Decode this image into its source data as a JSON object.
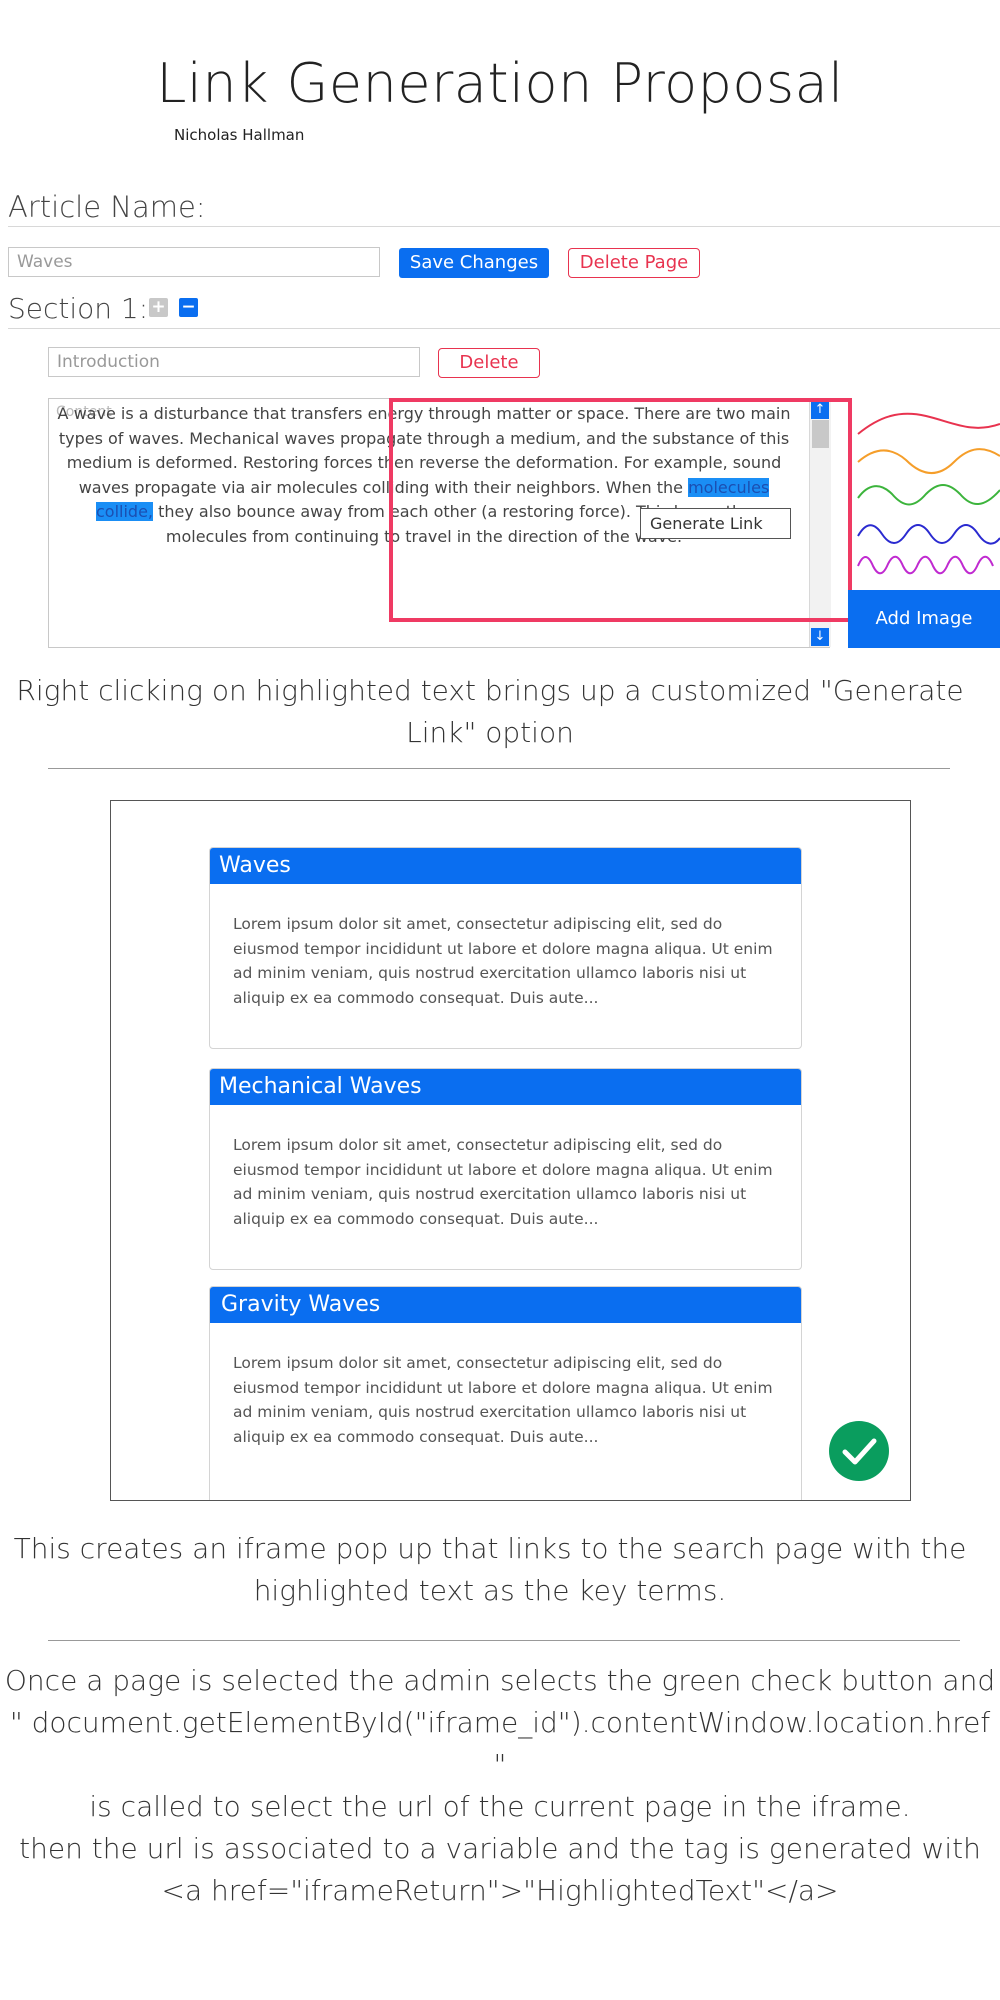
{
  "header": {
    "title": "Link Generation Proposal",
    "author": "Nicholas Hallman"
  },
  "article": {
    "label": "Article Name:",
    "name_value": "Waves",
    "save_label": "Save Changes",
    "delete_page_label": "Delete Page"
  },
  "section": {
    "label": "Section 1:",
    "add_icon": "plus-icon",
    "remove_icon": "minus-icon",
    "title_value": "Introduction",
    "delete_label": "Delete",
    "content_placeholder": "Content",
    "content_before": "A wave is a disturbance that transfers energy through matter or space. There are two main types of waves. Mechanical waves propagate through a medium, and the substance of this medium is deformed. Restoring forces then reverse the deformation. For example, sound waves propagate via air molecules colliding with their neighbors. When the ",
    "content_highlight": "molecules collide,",
    "content_after": " they also bounce away from each other (a restoring force). This keeps the molecules from continuing to travel in the direction of the wave.",
    "context_menu_item": "Generate Link",
    "add_image_label": "Add Image",
    "wave_colors": [
      "#e8334f",
      "#f59e2a",
      "#3cb43c",
      "#2a2ad0",
      "#c02ad0"
    ]
  },
  "captions": {
    "right_click": "Right clicking on highlighted text brings up a customized \"Generate Link\" option",
    "iframe": "This creates an iframe pop up that links to the search page with the highlighted text as the key terms.",
    "explanation_1": "Once a page is selected the admin selects the green check button and",
    "explanation_2": "\" document.getElementById(\"iframe_id\").contentWindow.location.href \"",
    "explanation_3": "is called to select the url of the current page in the iframe.",
    "explanation_4": "then the url is associated to a variable and the tag is generated with",
    "explanation_5": "<a href=\"iframeReturn\">\"HighlightedText\"</a>"
  },
  "iframe": {
    "results": [
      {
        "title": "Waves",
        "body": "Lorem ipsum dolor sit amet, consectetur adipiscing elit, sed do eiusmod tempor incididunt ut labore et dolore magna aliqua. Ut enim ad minim veniam, quis nostrud exercitation ullamco laboris nisi ut aliquip ex ea commodo consequat. Duis aute..."
      },
      {
        "title": "Mechanical Waves",
        "body": "Lorem ipsum dolor sit amet, consectetur adipiscing elit, sed do eiusmod tempor incididunt ut labore et dolore magna aliqua. Ut enim ad minim veniam, quis nostrud exercitation ullamco laboris nisi ut aliquip ex ea commodo consequat. Duis aute..."
      },
      {
        "title": "Gravity Waves",
        "body": "Lorem ipsum dolor sit amet, consectetur adipiscing elit, sed do eiusmod tempor incididunt ut labore et dolore magna aliqua. Ut enim ad minim veniam, quis nostrud exercitation ullamco laboris nisi ut aliquip ex ea commodo consequat. Duis aute..."
      }
    ],
    "confirm_icon": "check-icon",
    "accent_color": "#0a6ef0",
    "confirm_color": "#0a9d5e"
  }
}
